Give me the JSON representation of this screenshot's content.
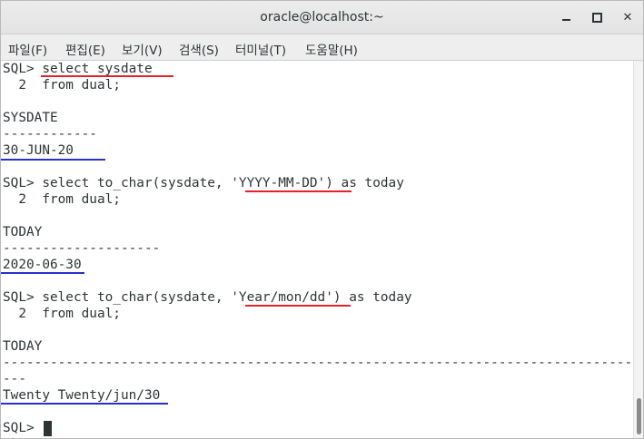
{
  "window": {
    "title": "oracle@localhost:~"
  },
  "menu": [
    "파일(F)",
    "편집(E)",
    "보기(V)",
    "검색(S)",
    "터미널(T)",
    "도움말(H)"
  ],
  "terminal": {
    "lines": [
      "SQL> select sysdate",
      "  2  from dual;",
      "",
      "SYSDATE",
      "------------",
      "30-JUN-20",
      "",
      "SQL> select to_char(sysdate, 'YYYY-MM-DD') as today",
      "  2  from dual;",
      "",
      "TODAY",
      "--------------------",
      "2020-06-30",
      "",
      "SQL> select to_char(sysdate, 'Year/mon/dd') as today",
      "  2  from dual;",
      "",
      "TODAY",
      "----------------------------------------------------------------------------------------",
      "---",
      "Twenty Twenty/jun/30",
      "",
      "SQL> "
    ]
  }
}
